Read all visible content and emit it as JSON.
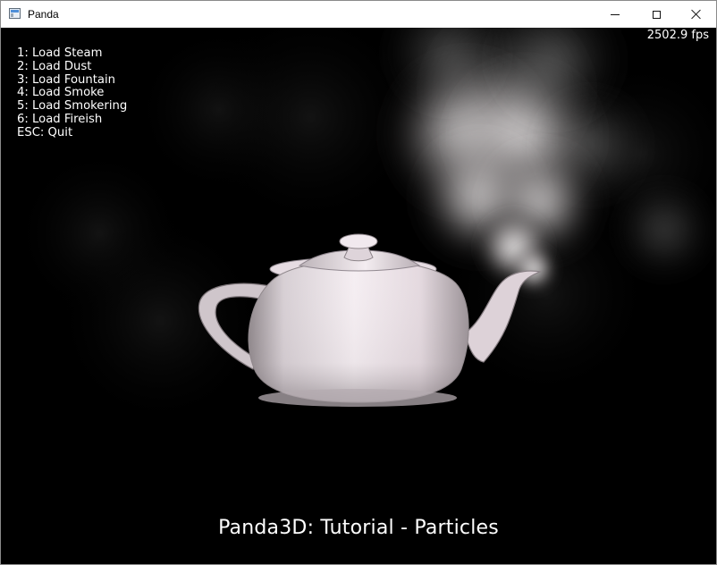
{
  "window": {
    "title": "Panda",
    "app_icon": "panda-window-icon",
    "controls": {
      "minimize_icon": "minimize-icon",
      "maximize_icon": "maximize-icon",
      "close_icon": "close-icon"
    }
  },
  "scene": {
    "fps": "2502.9 fps",
    "instructions": [
      "1: Load Steam",
      "2: Load Dust",
      "3: Load Fountain",
      "4: Load Smoke",
      "5: Load Smokering",
      "6: Load Fireish",
      "ESC: Quit"
    ],
    "title": "Panda3D: Tutorial - Particles",
    "colors": {
      "background": "#000000",
      "text": "#ffffff",
      "teapot": "#ddd2d8",
      "steam": "#d8d3d4"
    }
  }
}
